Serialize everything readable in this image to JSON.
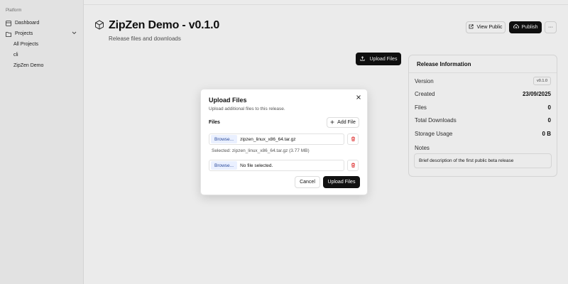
{
  "sidebar": {
    "section": "Platform",
    "dashboard": "Dashboard",
    "projects": "Projects",
    "sub_items": [
      "All Projects",
      "cli",
      "ZipZen Demo"
    ]
  },
  "header": {
    "title": "ZipZen Demo - v0.1.0",
    "subtitle": "Release files and downloads",
    "view_public": "View Public",
    "publish": "Publish",
    "more": "···"
  },
  "upload_button": "Upload Files",
  "release_info": {
    "title": "Release Information",
    "rows": [
      {
        "label": "Version",
        "value": "v0.1.0"
      },
      {
        "label": "Created",
        "value": "23/09/2025"
      },
      {
        "label": "Files",
        "value": "0"
      },
      {
        "label": "Total Downloads",
        "value": "0"
      },
      {
        "label": "Storage Usage",
        "value": "0 B"
      }
    ],
    "notes_label": "Notes",
    "notes": "Brief description of the first public beta release"
  },
  "modal": {
    "title": "Upload Files",
    "description": "Upload additional files to this release.",
    "files_label": "Files",
    "add_file": "Add File",
    "browse": "Browse...",
    "file1": "zipzen_linux_x86_64.tar.gz",
    "selected": "Selected: zipzen_linux_x86_64.tar.gz (3.77 MB)",
    "file2": "No file selected.",
    "cancel": "Cancel",
    "upload": "Upload Files"
  },
  "colors": {
    "primary": "#111111",
    "danger": "#dc2626",
    "browse_bg": "#eaf0ff"
  }
}
